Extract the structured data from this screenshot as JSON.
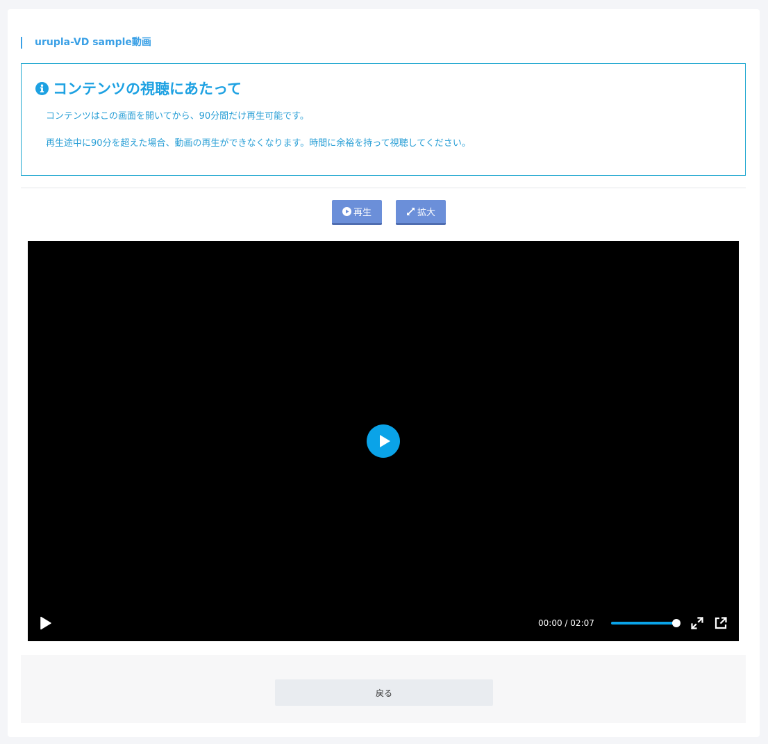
{
  "page": {
    "title": "urupla-VD sample動画"
  },
  "notice": {
    "heading": "コンテンツの視聴にあたって",
    "lines": [
      "コンテンツはこの画面を開いてから、90分間だけ再生可能です。",
      "再生途中に90分を超えた場合、動画の再生ができなくなります。時間に余裕を持って視聴してください。"
    ]
  },
  "toolbar": {
    "play_label": "再生",
    "expand_label": "拡大"
  },
  "player": {
    "current_time": "00:00",
    "separator": "/",
    "duration": "02:07",
    "volume_fraction": 1.0
  },
  "footer": {
    "back_label": "戻る"
  },
  "colors": {
    "accent": "#1da1e2",
    "button": "#6b8fd9",
    "player_accent": "#0aa3e8"
  },
  "icons": {
    "notice": "info-circle-icon",
    "play_button": "play-circle-icon",
    "expand_button": "expand-arrows-icon",
    "big_play": "play-icon",
    "fullscreen": "fullscreen-icon",
    "popout": "external-link-icon"
  }
}
